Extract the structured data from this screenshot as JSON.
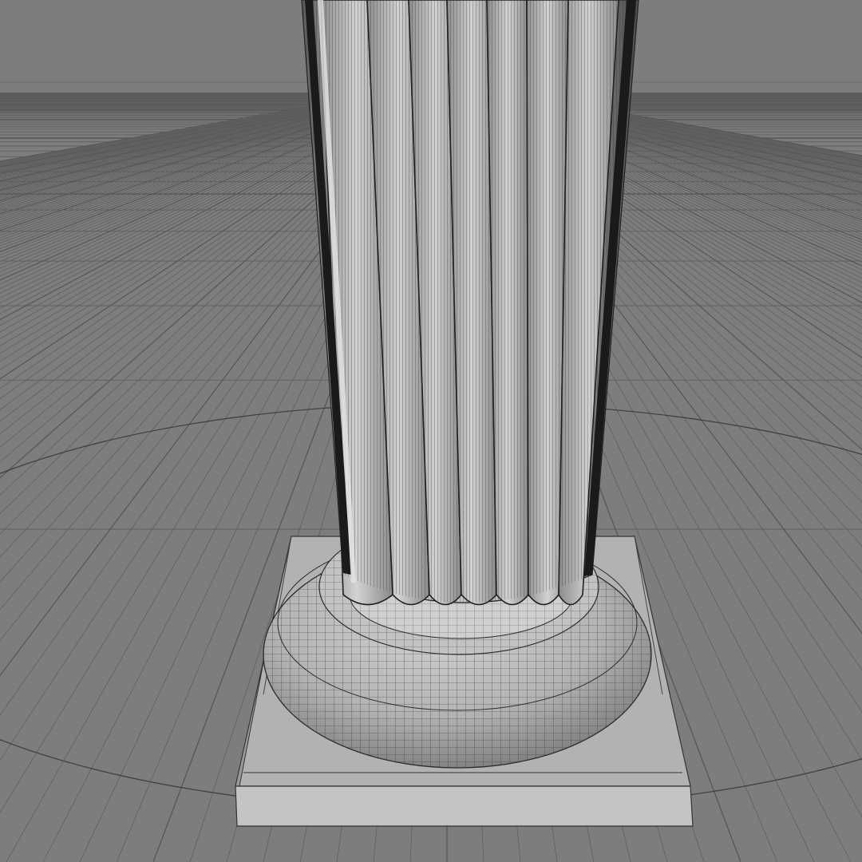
{
  "viewport": {
    "mode": "perspective",
    "display": "wireframe-on-shaded",
    "background_color": "#7d7d7d",
    "grid_line_color": "#5f5f5f",
    "grid_major_color": "#575757",
    "model": {
      "type": "column-base",
      "parts": [
        "fluted-shaft",
        "torus-ring",
        "round-base",
        "square-plinth"
      ],
      "surface_color": "#b9b9b9",
      "wire_color": "#3a3a3a"
    }
  }
}
